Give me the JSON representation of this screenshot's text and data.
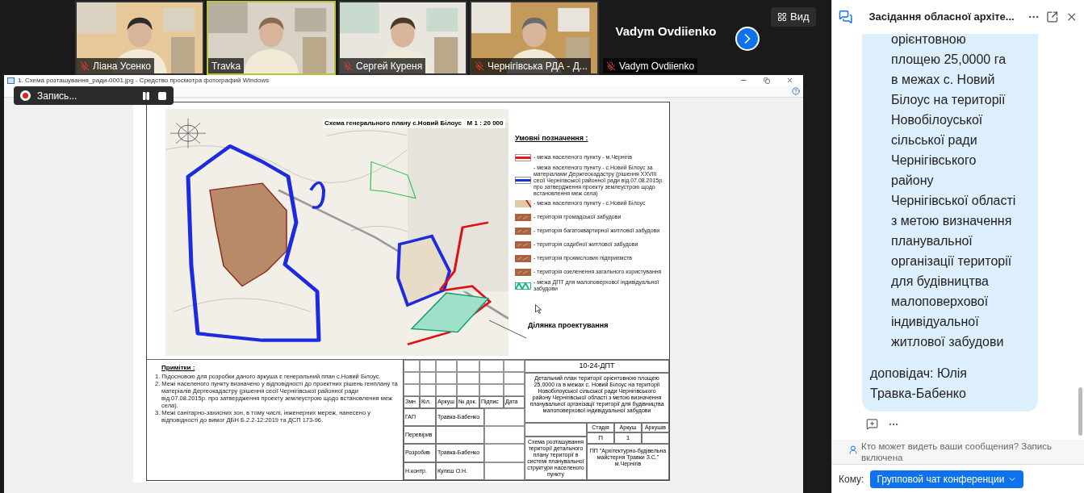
{
  "participants": [
    {
      "name": "Ліана Усенко",
      "muted": true,
      "speaking": false,
      "kind": "video"
    },
    {
      "name": "Travka",
      "muted": false,
      "speaking": true,
      "kind": "video"
    },
    {
      "name": "Сергей Куреня",
      "muted": true,
      "speaking": false,
      "kind": "video"
    },
    {
      "name": "Чернігівська РДА - Д...",
      "muted": true,
      "speaking": false,
      "kind": "video"
    },
    {
      "name": "Vadym Ovdiienko",
      "muted": true,
      "speaking": false,
      "kind": "no_video",
      "display_name": "Vadym Ovdiienko"
    }
  ],
  "view_button": "Вид",
  "viewer": {
    "title": "1. Схема розташування_ради-0001.jpg - Средство просмотра фотографий Windows",
    "recording": {
      "label": "Запись..."
    }
  },
  "drawing": {
    "map_title": "Схема генерального плану с.Новий Білоус   М 1 : 20 000",
    "legend_title": "Умовні позначення :",
    "legend": [
      {
        "kind": "red_line",
        "label": "- межа населеного пункту - м.Чернігів"
      },
      {
        "kind": "blue_line",
        "label": "- межа населеного пункту - с.Новий Білоус за матеріалами Держгеокадастру (рішення XXVIII сесії Чернігівської районної ради від.07.08.2015р. про затвердження проекту землеустрою щодо встановлення меж села)"
      },
      {
        "kind": "boundary",
        "label": "- межа населеного пункту - с.Новий Білоус"
      },
      {
        "kind": "zone",
        "label": "- територія громадської забудови"
      },
      {
        "kind": "zone",
        "label": "- територія багатоквартирної житлової забудови"
      },
      {
        "kind": "zone",
        "label": "- територія садибної житлової забудови"
      },
      {
        "kind": "zone",
        "label": "- територія промислових підприємств"
      },
      {
        "kind": "zone",
        "label": "- територія озеленення загального користування"
      },
      {
        "kind": "hatch",
        "label": "- межа ДПТ для малоповерхової індивідуальної забудови"
      }
    ],
    "site_label": "Ділянка проектування",
    "notes_title": "Примітки :",
    "notes": [
      "1. Підосновою для розробки даного аркуша є генеральний план с.Новий Білоус.",
      "2. Межі населеного пункту визначено у відповідності до проектних рішень генплану та матеріалів Дергеокадастру (рішення сесії Чернігівської районної ради від.07.08.2015р. про затвердження проекту землеустрою щодо встановлення меж села).",
      "3. Межі санітарно-захисних зон, в тому числі, інженерних мереж, нанесено у відповідності до вимог ДБН Б.2.2-12:2019 та ДСП 173-96."
    ],
    "title_block": {
      "code": "10-24-ДПТ",
      "description": "Детальний план території орієнтовною площею 25,0000 га в межах с. Новий Білоус на території Новобілоуської сільської ради Чернігівського району Чернігівської області з метою визначення планувальної організації території для будівництва малоповерхової індивідуальної забудови",
      "headers": [
        "Змн",
        "Кіл.",
        "Аркуш",
        "№ док.",
        "Підпис",
        "Дата"
      ],
      "signers": [
        {
          "role": "ГАП",
          "name": "Травка-Бабенко"
        },
        {
          "role": "Перевірив"
        },
        {
          "role": "Розробив",
          "name": "Травка-Бабенко"
        },
        {
          "role": "Н.контр.",
          "name": "Кулєш О.Н."
        }
      ],
      "stage_headers": [
        "Стадія",
        "Аркуш",
        "Аркушів"
      ],
      "stage_values": [
        "П",
        "1"
      ],
      "sheet_name": "Схема розташування території детального плану території в системі планувальної структури населеного пункту",
      "company": "ПП \"Архітектурно-будівельна майстерня Травки З.С.\" м.Чернігів"
    }
  },
  "chat": {
    "title": "Засідання обласної архіте...",
    "message": "орієнтовною\nплощею 25,0000 га\nв межах с. Новий\nБілоус на території\nНовобілоуської\nсільської ради\nЧернігівського\nрайону\nЧернігівської області\nз метою визначення\nпланувальної\nорганізації території\nдля будівництва\nмалоповерхової\nіндивідуальної\nжитлової забудови",
    "speaker": "доповідач: Юлія Травка-Бабенко",
    "notice": "Кто может видеть ваши сообщения? Запись включена",
    "to_label": "Кому:",
    "recipient": "Групповой чат конференции"
  }
}
